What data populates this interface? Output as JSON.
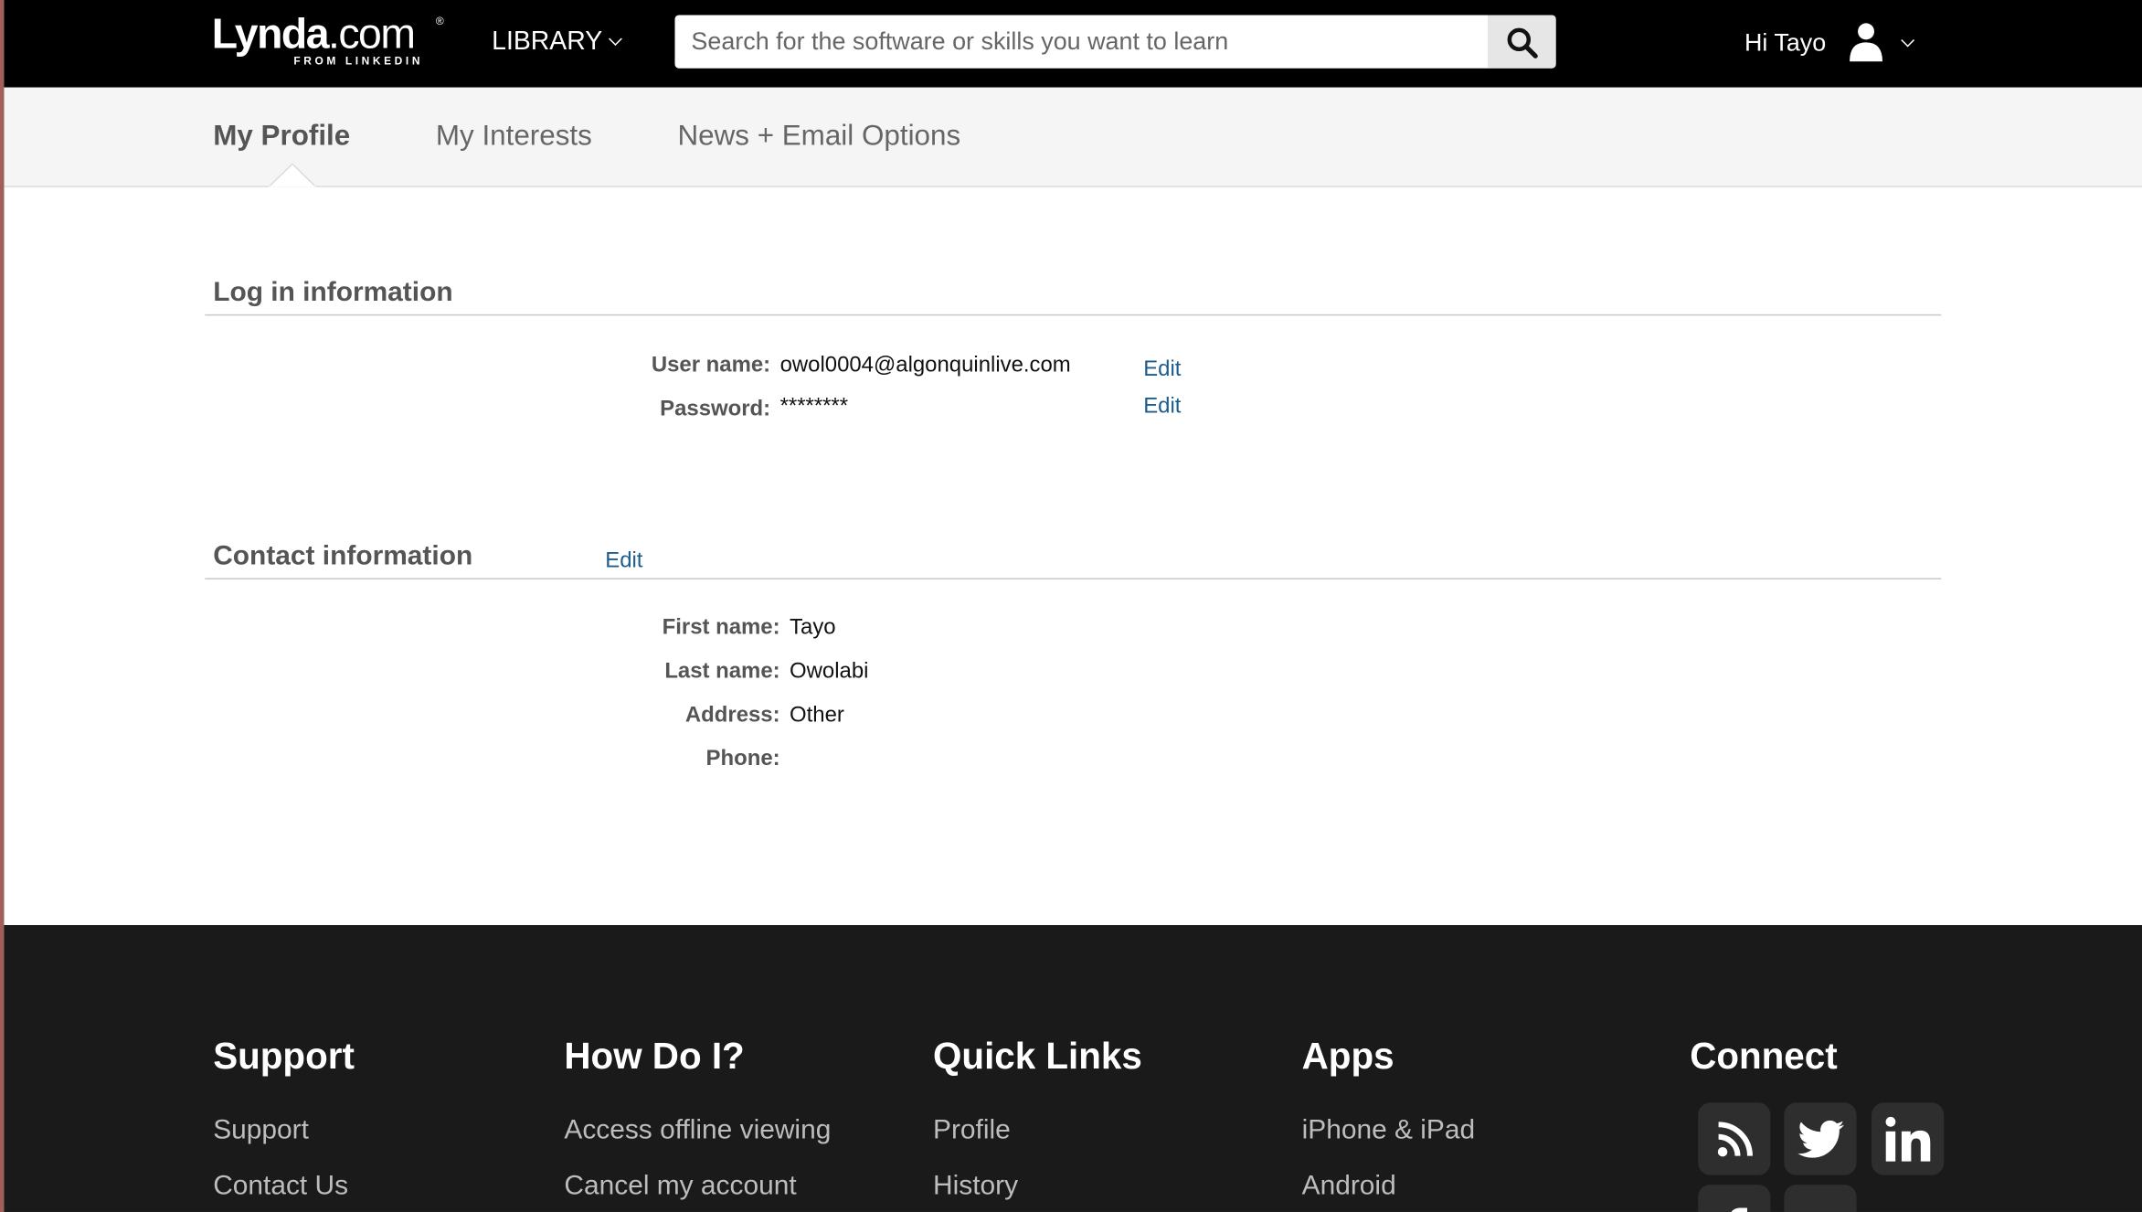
{
  "header": {
    "logo_main": "Lynda",
    "logo_dot": ".com",
    "logo_reg": "®",
    "logo_sub": "FROM LINKEDIN",
    "library_label": "LIBRARY",
    "search_placeholder": "Search for the software or skills you want to learn",
    "search_value": "",
    "greeting": "Hi Tayo"
  },
  "tabs": [
    {
      "label": "My Profile",
      "active": true
    },
    {
      "label": "My Interests",
      "active": false
    },
    {
      "label": "News + Email Options",
      "active": false
    }
  ],
  "login": {
    "title": "Log in information",
    "fields": [
      {
        "label": "User name:",
        "value": "owol0004@algonquinlive.com",
        "edit": "Edit"
      },
      {
        "label": "Password:",
        "value": "********",
        "edit": "Edit"
      }
    ]
  },
  "contact": {
    "title": "Contact information",
    "edit": "Edit",
    "fields": [
      {
        "label": "First name:",
        "value": "Tayo"
      },
      {
        "label": "Last name:",
        "value": "Owolabi"
      },
      {
        "label": "Address:",
        "value": "Other"
      },
      {
        "label": "Phone:",
        "value": ""
      }
    ]
  },
  "footer": {
    "columns": [
      {
        "title": "Support",
        "links": [
          "Support",
          "Contact Us"
        ]
      },
      {
        "title": "How Do I?",
        "links": [
          "Access offline viewing",
          "Cancel my account"
        ]
      },
      {
        "title": "Quick Links",
        "links": [
          "Profile",
          "History"
        ]
      },
      {
        "title": "Apps",
        "links": [
          "iPhone & iPad",
          "Android"
        ]
      },
      {
        "title": "Connect",
        "links": []
      }
    ],
    "social_icons": [
      "rss-icon",
      "twitter-icon",
      "linkedin-icon",
      "facebook-icon",
      "social-icon"
    ]
  },
  "colors": {
    "header_bg": "#000000",
    "footer_bg": "#1a1a1a",
    "link": "#1d5d8e"
  }
}
